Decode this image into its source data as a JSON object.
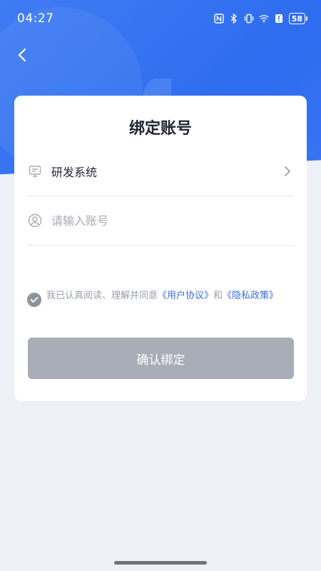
{
  "status_bar": {
    "time": "04:27",
    "battery": "58",
    "icons": [
      "nfc-icon",
      "bluetooth-icon",
      "vibrate-icon",
      "wifi-icon",
      "alert-icon",
      "battery-icon"
    ]
  },
  "page": {
    "title": "绑定账号"
  },
  "form": {
    "system_label": "研发系统",
    "account_placeholder": "请输入账号",
    "account_value": ""
  },
  "agreement": {
    "prefix": "我已认真阅读、理解并同意",
    "user_agreement": "《用户协议》",
    "conjunction": "和",
    "privacy_policy": "《隐私政策》",
    "checked": true
  },
  "confirm_button": {
    "label": "确认绑定"
  },
  "colors": {
    "primary": "#2e6cf0",
    "link": "#3b6fe0",
    "button_disabled": "#a8adb8",
    "background": "#eef1f7"
  }
}
